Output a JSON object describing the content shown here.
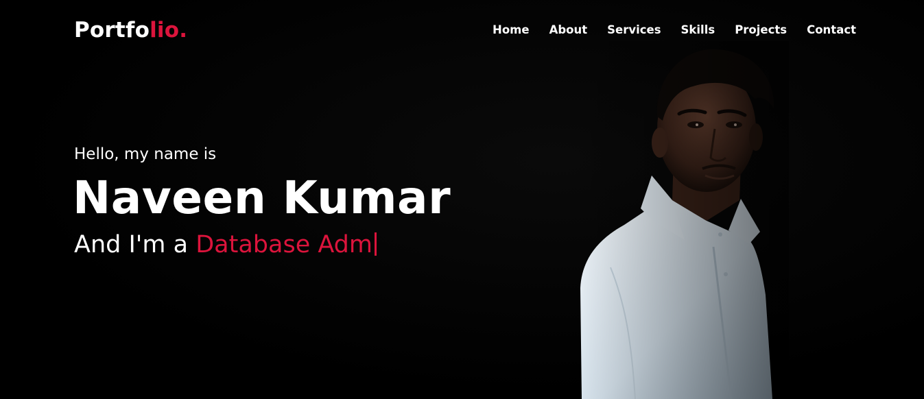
{
  "navbar": {
    "logo_main": "Portfo",
    "logo_accent": "lio.",
    "menu": [
      {
        "label": "Home"
      },
      {
        "label": "About"
      },
      {
        "label": "Services"
      },
      {
        "label": "Skills"
      },
      {
        "label": "Projects"
      },
      {
        "label": "Contact"
      }
    ]
  },
  "hero": {
    "greeting": "Hello, my name is",
    "name": "Naveen Kumar",
    "role_prefix": "And I'm a ",
    "role_typed": "Database Adm"
  },
  "colors": {
    "background": "#000000",
    "accent": "#dc143c",
    "text": "#ffffff"
  }
}
